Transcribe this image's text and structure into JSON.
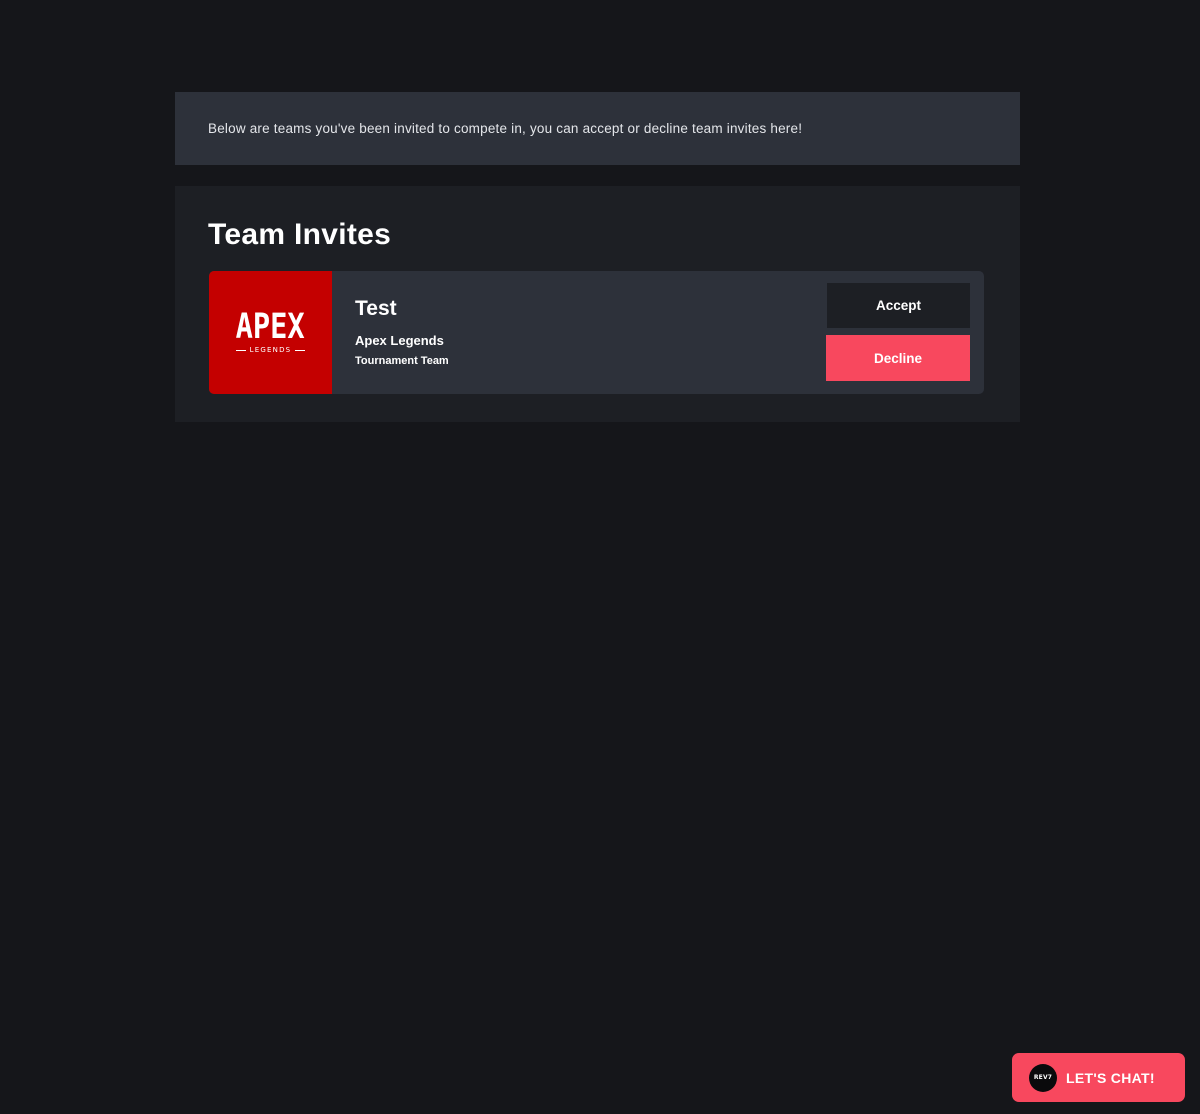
{
  "banner": {
    "text": "Below are teams you've been invited to compete in, you can accept or decline team invites here!"
  },
  "invites": {
    "title": "Team Invites",
    "items": [
      {
        "logo": {
          "word": "APEX",
          "sub": "LEGENDS",
          "color": "#c40000"
        },
        "team_name": "Test",
        "game": "Apex Legends",
        "type": "Tournament Team",
        "accept_label": "Accept",
        "decline_label": "Decline"
      }
    ]
  },
  "chat": {
    "label": "LET'S CHAT!",
    "avatar_text": "REV7"
  },
  "colors": {
    "background": "#15161a",
    "panel": "#1d1f24",
    "card": "#2d313a",
    "accent": "#f8485e"
  }
}
